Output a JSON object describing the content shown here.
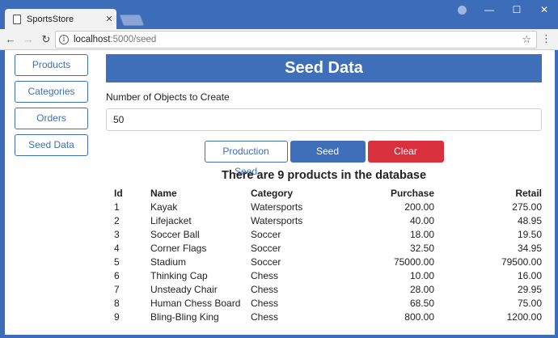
{
  "browser": {
    "tab_title": "SportsStore",
    "tab_close": "✕",
    "url_host": "localhost",
    "url_path": ":5000/seed",
    "window_controls": {
      "minimize": "—",
      "maximize": "☐",
      "close": "✕"
    }
  },
  "sidebar": {
    "items": [
      {
        "label": "Products"
      },
      {
        "label": "Categories"
      },
      {
        "label": "Orders"
      },
      {
        "label": "Seed Data"
      }
    ]
  },
  "main": {
    "title": "Seed Data",
    "field_label": "Number of Objects to Create",
    "count_value": "50",
    "buttons": {
      "production_seed": "Production Seed",
      "seed_database": "Seed Database",
      "clear_database": "Clear Database"
    },
    "count_heading": "There are 9 products in the database"
  },
  "table": {
    "headers": {
      "id": "Id",
      "name": "Name",
      "category": "Category",
      "purchase": "Purchase",
      "retail": "Retail"
    },
    "rows": [
      {
        "id": "1",
        "name": "Kayak",
        "category": "Watersports",
        "purchase": "200.00",
        "retail": "275.00"
      },
      {
        "id": "2",
        "name": "Lifejacket",
        "category": "Watersports",
        "purchase": "40.00",
        "retail": "48.95"
      },
      {
        "id": "3",
        "name": "Soccer Ball",
        "category": "Soccer",
        "purchase": "18.00",
        "retail": "19.50"
      },
      {
        "id": "4",
        "name": "Corner Flags",
        "category": "Soccer",
        "purchase": "32.50",
        "retail": "34.95"
      },
      {
        "id": "5",
        "name": "Stadium",
        "category": "Soccer",
        "purchase": "75000.00",
        "retail": "79500.00"
      },
      {
        "id": "6",
        "name": "Thinking Cap",
        "category": "Chess",
        "purchase": "10.00",
        "retail": "16.00"
      },
      {
        "id": "7",
        "name": "Unsteady Chair",
        "category": "Chess",
        "purchase": "28.00",
        "retail": "29.95"
      },
      {
        "id": "8",
        "name": "Human Chess Board",
        "category": "Chess",
        "purchase": "68.50",
        "retail": "75.00"
      },
      {
        "id": "9",
        "name": "Bling-Bling King",
        "category": "Chess",
        "purchase": "800.00",
        "retail": "1200.00"
      }
    ]
  },
  "colors": {
    "accent": "#3f6fb9",
    "danger": "#d9303e",
    "chrome": "#3d6db8"
  }
}
